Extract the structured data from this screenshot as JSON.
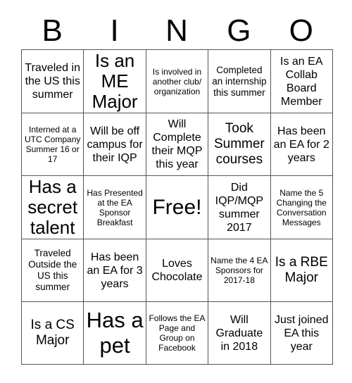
{
  "card": {
    "title": "BINGO",
    "header_letters": [
      "B",
      "I",
      "N",
      "G",
      "O"
    ],
    "free_space_label": "Free!",
    "rows": [
      [
        {
          "text": "Traveled in the US this summer",
          "size": "fs-md"
        },
        {
          "text": "Is an ME Major",
          "size": "fs-xl"
        },
        {
          "text": "Is involved in another club/ organization",
          "size": "fs-xs"
        },
        {
          "text": "Completed an internship this summer",
          "size": "fs-sm"
        },
        {
          "text": "Is an EA Collab Board Member",
          "size": "fs-md"
        }
      ],
      [
        {
          "text": "Interned at a UTC Company Summer 16 or 17",
          "size": "fs-xs"
        },
        {
          "text": "Will be off campus for their IQP",
          "size": "fs-md"
        },
        {
          "text": "Will Complete their MQP this year",
          "size": "fs-md"
        },
        {
          "text": "Took Summer courses",
          "size": "fs-lg"
        },
        {
          "text": "Has been an EA for 2 years",
          "size": "fs-md"
        }
      ],
      [
        {
          "text": "Has a secret talent",
          "size": "fs-xl"
        },
        {
          "text": "Has Presented at the EA Sponsor Breakfast",
          "size": "fs-xs"
        },
        {
          "text": "Free!",
          "size": "fs-free"
        },
        {
          "text": "Did IQP/MQP summer 2017",
          "size": "fs-md"
        },
        {
          "text": "Name the 5 Changing the Conversation Messages",
          "size": "fs-xs"
        }
      ],
      [
        {
          "text": "Traveled Outside the US this summer",
          "size": "fs-sm"
        },
        {
          "text": "Has been an EA for 3 years",
          "size": "fs-md"
        },
        {
          "text": "Loves Chocolate",
          "size": "fs-md"
        },
        {
          "text": "Name the 4 EA Sponsors for 2017-18",
          "size": "fs-xs"
        },
        {
          "text": "Is a RBE Major",
          "size": "fs-lg"
        }
      ],
      [
        {
          "text": "Is a CS Major",
          "size": "fs-lg"
        },
        {
          "text": "Has a pet",
          "size": "fs-huge"
        },
        {
          "text": "Follows the EA Page and Group on Facebook",
          "size": "fs-xs"
        },
        {
          "text": "Will Graduate in 2018",
          "size": "fs-md"
        },
        {
          "text": "Just joined EA this year",
          "size": "fs-md"
        }
      ]
    ]
  },
  "colors": {
    "background": "#ffffff",
    "text": "#000000",
    "grid_line": "#555555",
    "outer_border": "#000000"
  }
}
